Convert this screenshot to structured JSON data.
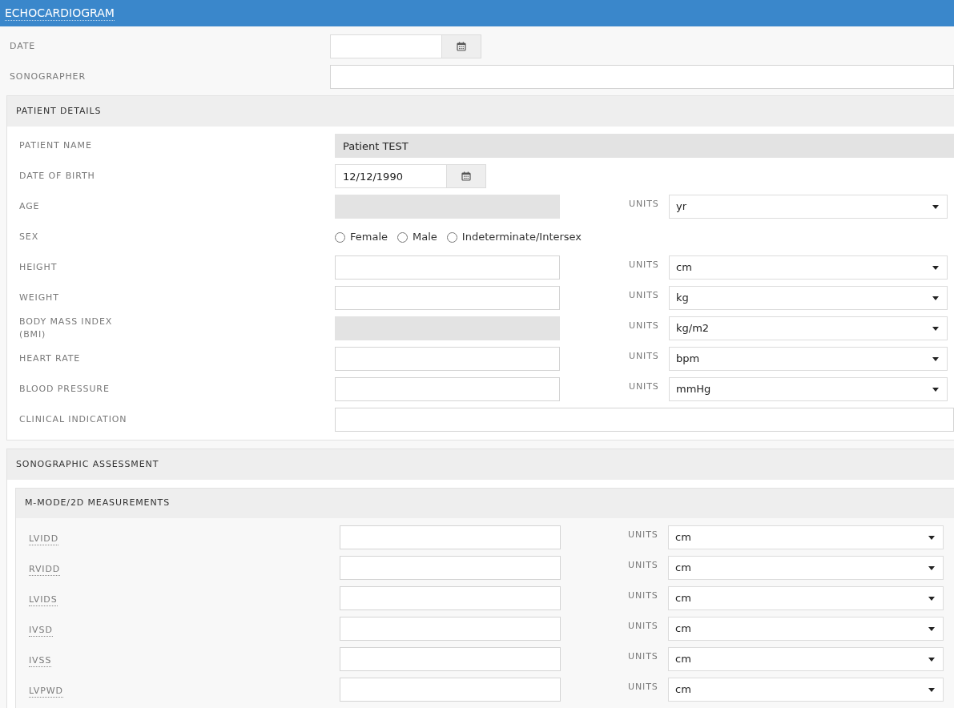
{
  "title": "ECHOCARDIOGRAM",
  "top_fields": [
    {
      "kind": "date",
      "label": "DATE"
    },
    {
      "kind": "wide",
      "label": "SONOGRAPHER",
      "disabled": false
    }
  ],
  "patient_details": {
    "title": "PATIENT DETAILS",
    "rows": [
      {
        "kind": "wide",
        "label": "PATIENT NAME",
        "value": "Patient TEST",
        "disabled": true
      },
      {
        "kind": "date",
        "label": "DATE OF BIRTH",
        "value": "12/12/1990"
      },
      {
        "kind": "measure",
        "label": "AGE",
        "disabled": true,
        "units_label": "UNITS",
        "unit": "yr"
      },
      {
        "kind": "radio",
        "label": "SEX",
        "options": [
          {
            "label": "Female",
            "selected": false
          },
          {
            "label": "Male",
            "selected": false
          },
          {
            "label": "Indeterminate/Intersex",
            "selected": false
          }
        ]
      },
      {
        "kind": "measure",
        "label": "HEIGHT",
        "disabled": false,
        "units_label": "UNITS",
        "unit": "cm"
      },
      {
        "kind": "measure",
        "label": "WEIGHT",
        "disabled": false,
        "units_label": "UNITS",
        "unit": "kg"
      },
      {
        "kind": "measure",
        "label": "BODY MASS INDEX (BMI)",
        "disabled": true,
        "units_label": "UNITS",
        "unit": "kg/m2"
      },
      {
        "kind": "measure",
        "label": "HEART RATE",
        "disabled": false,
        "units_label": "UNITS",
        "unit": "bpm"
      },
      {
        "kind": "measure",
        "label": "BLOOD PRESSURE",
        "disabled": false,
        "units_label": "UNITS",
        "unit": "mmHg"
      },
      {
        "kind": "wide",
        "label": "CLINICAL INDICATION",
        "disabled": false
      }
    ]
  },
  "sonographic_assessment": {
    "title": "SONOGRAPHIC ASSESSMENT",
    "sections": [
      {
        "title": "M-MODE/2D MEASUREMENTS",
        "rows": [
          {
            "kind": "measure",
            "label": "LVIDD",
            "disabled": false,
            "units_label": "UNITS",
            "unit": "cm"
          },
          {
            "kind": "measure",
            "label": "RVIDD",
            "disabled": false,
            "units_label": "UNITS",
            "unit": "cm"
          },
          {
            "kind": "measure",
            "label": "LVIDS",
            "disabled": false,
            "units_label": "UNITS",
            "unit": "cm"
          },
          {
            "kind": "measure",
            "label": "IVSD",
            "disabled": false,
            "units_label": "UNITS",
            "unit": "cm"
          },
          {
            "kind": "measure",
            "label": "IVSS",
            "disabled": false,
            "units_label": "UNITS",
            "unit": "cm"
          },
          {
            "kind": "measure",
            "label": "LVPWD",
            "disabled": false,
            "units_label": "UNITS",
            "unit": "cm"
          }
        ]
      }
    ]
  }
}
